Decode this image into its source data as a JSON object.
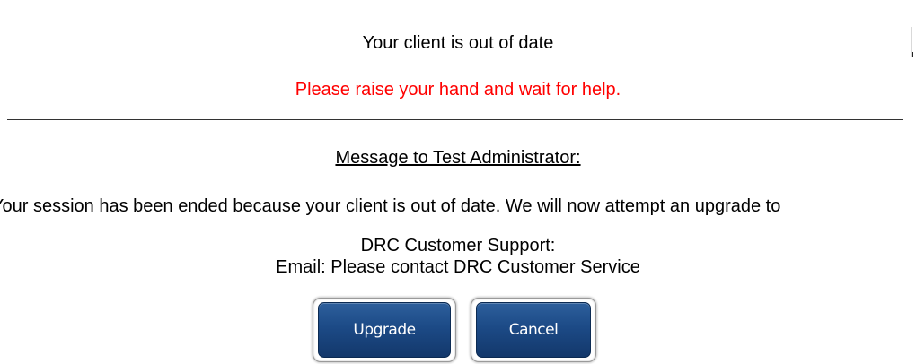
{
  "dialog": {
    "title": "Your client is out of date",
    "warning": "Please raise your hand and wait for help.",
    "admin_heading": "Message to Test Administrator:",
    "session_message": "Your session has been ended because your client is out of date. We will now attempt an upgrade to",
    "support_heading": "DRC Customer Support:",
    "support_email": "Email: Please contact DRC Customer Service",
    "colors": {
      "warning": "#ff0000",
      "button": "#1c4a86",
      "button_text": "#ffffff"
    }
  },
  "buttons": {
    "upgrade_label": "Upgrade",
    "cancel_label": "Cancel"
  }
}
